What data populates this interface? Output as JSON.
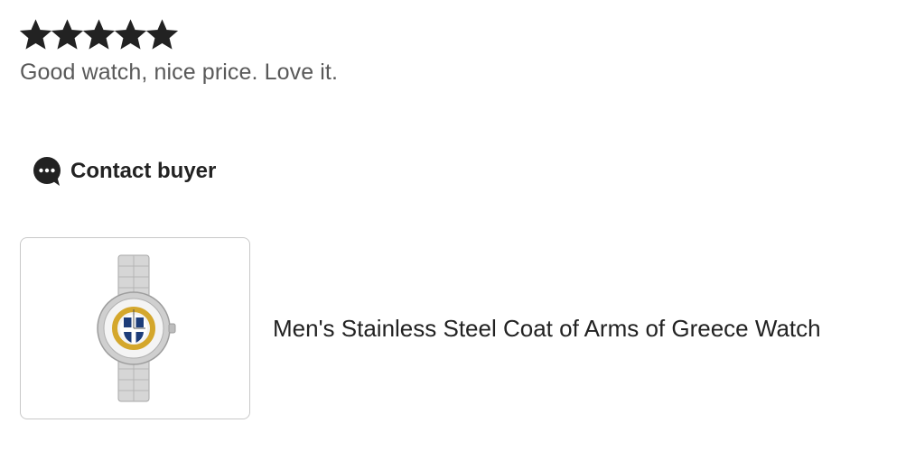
{
  "review": {
    "rating": 5,
    "rating_max": 5,
    "text": "Good watch, nice price. Love it."
  },
  "contact": {
    "label": "Contact buyer",
    "icon": "chat-bubble-icon"
  },
  "item": {
    "title": "Men's Stainless Steel Coat of Arms of Greece Watch",
    "image_icon": "watch-product-image"
  },
  "colors": {
    "star": "#222222",
    "review_text": "#595959",
    "thumb_border": "#c8c8c8"
  }
}
